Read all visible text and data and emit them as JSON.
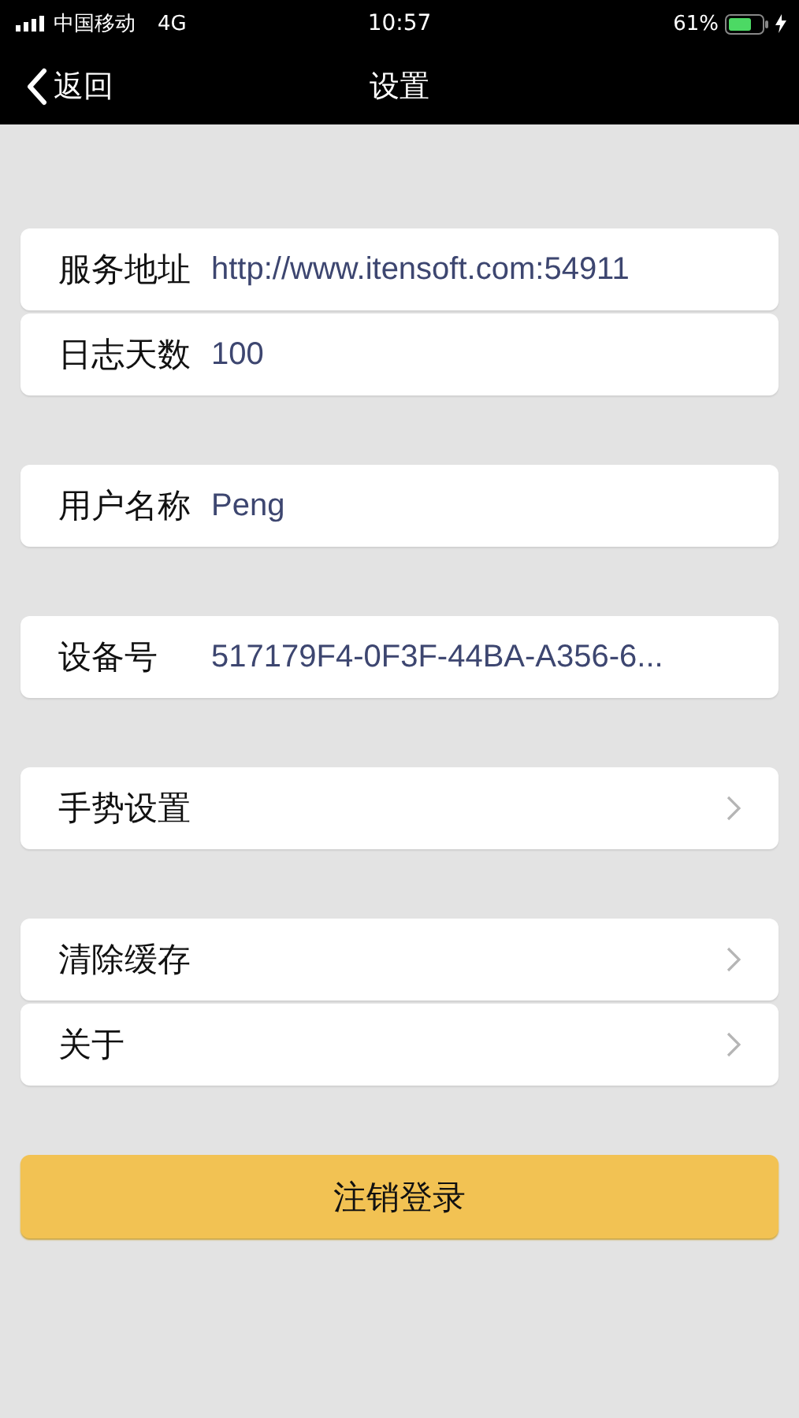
{
  "status_bar": {
    "carrier": "中国移动",
    "network": "4G",
    "time": "10:57",
    "battery": "61%",
    "charging": true
  },
  "nav_bar": {
    "back": "返回",
    "title": "设置"
  },
  "groups": [
    {
      "rows": [
        {
          "kind": "field",
          "label": "服务地址",
          "value": "http://www.itensoft.com:54911"
        },
        {
          "kind": "field",
          "label": "日志天数",
          "value": "100"
        }
      ]
    },
    {
      "rows": [
        {
          "kind": "field",
          "label": "用户名称",
          "value": "Peng"
        }
      ]
    },
    {
      "rows": [
        {
          "kind": "field",
          "label": "设备号",
          "value": "517179F4-0F3F-44BA-A356-6..."
        }
      ]
    },
    {
      "rows": [
        {
          "kind": "link",
          "label": "手势设置"
        }
      ]
    },
    {
      "rows": [
        {
          "kind": "link",
          "label": "清除缓存"
        },
        {
          "kind": "link",
          "label": "关于"
        }
      ]
    }
  ],
  "logout_button": "注销登录"
}
